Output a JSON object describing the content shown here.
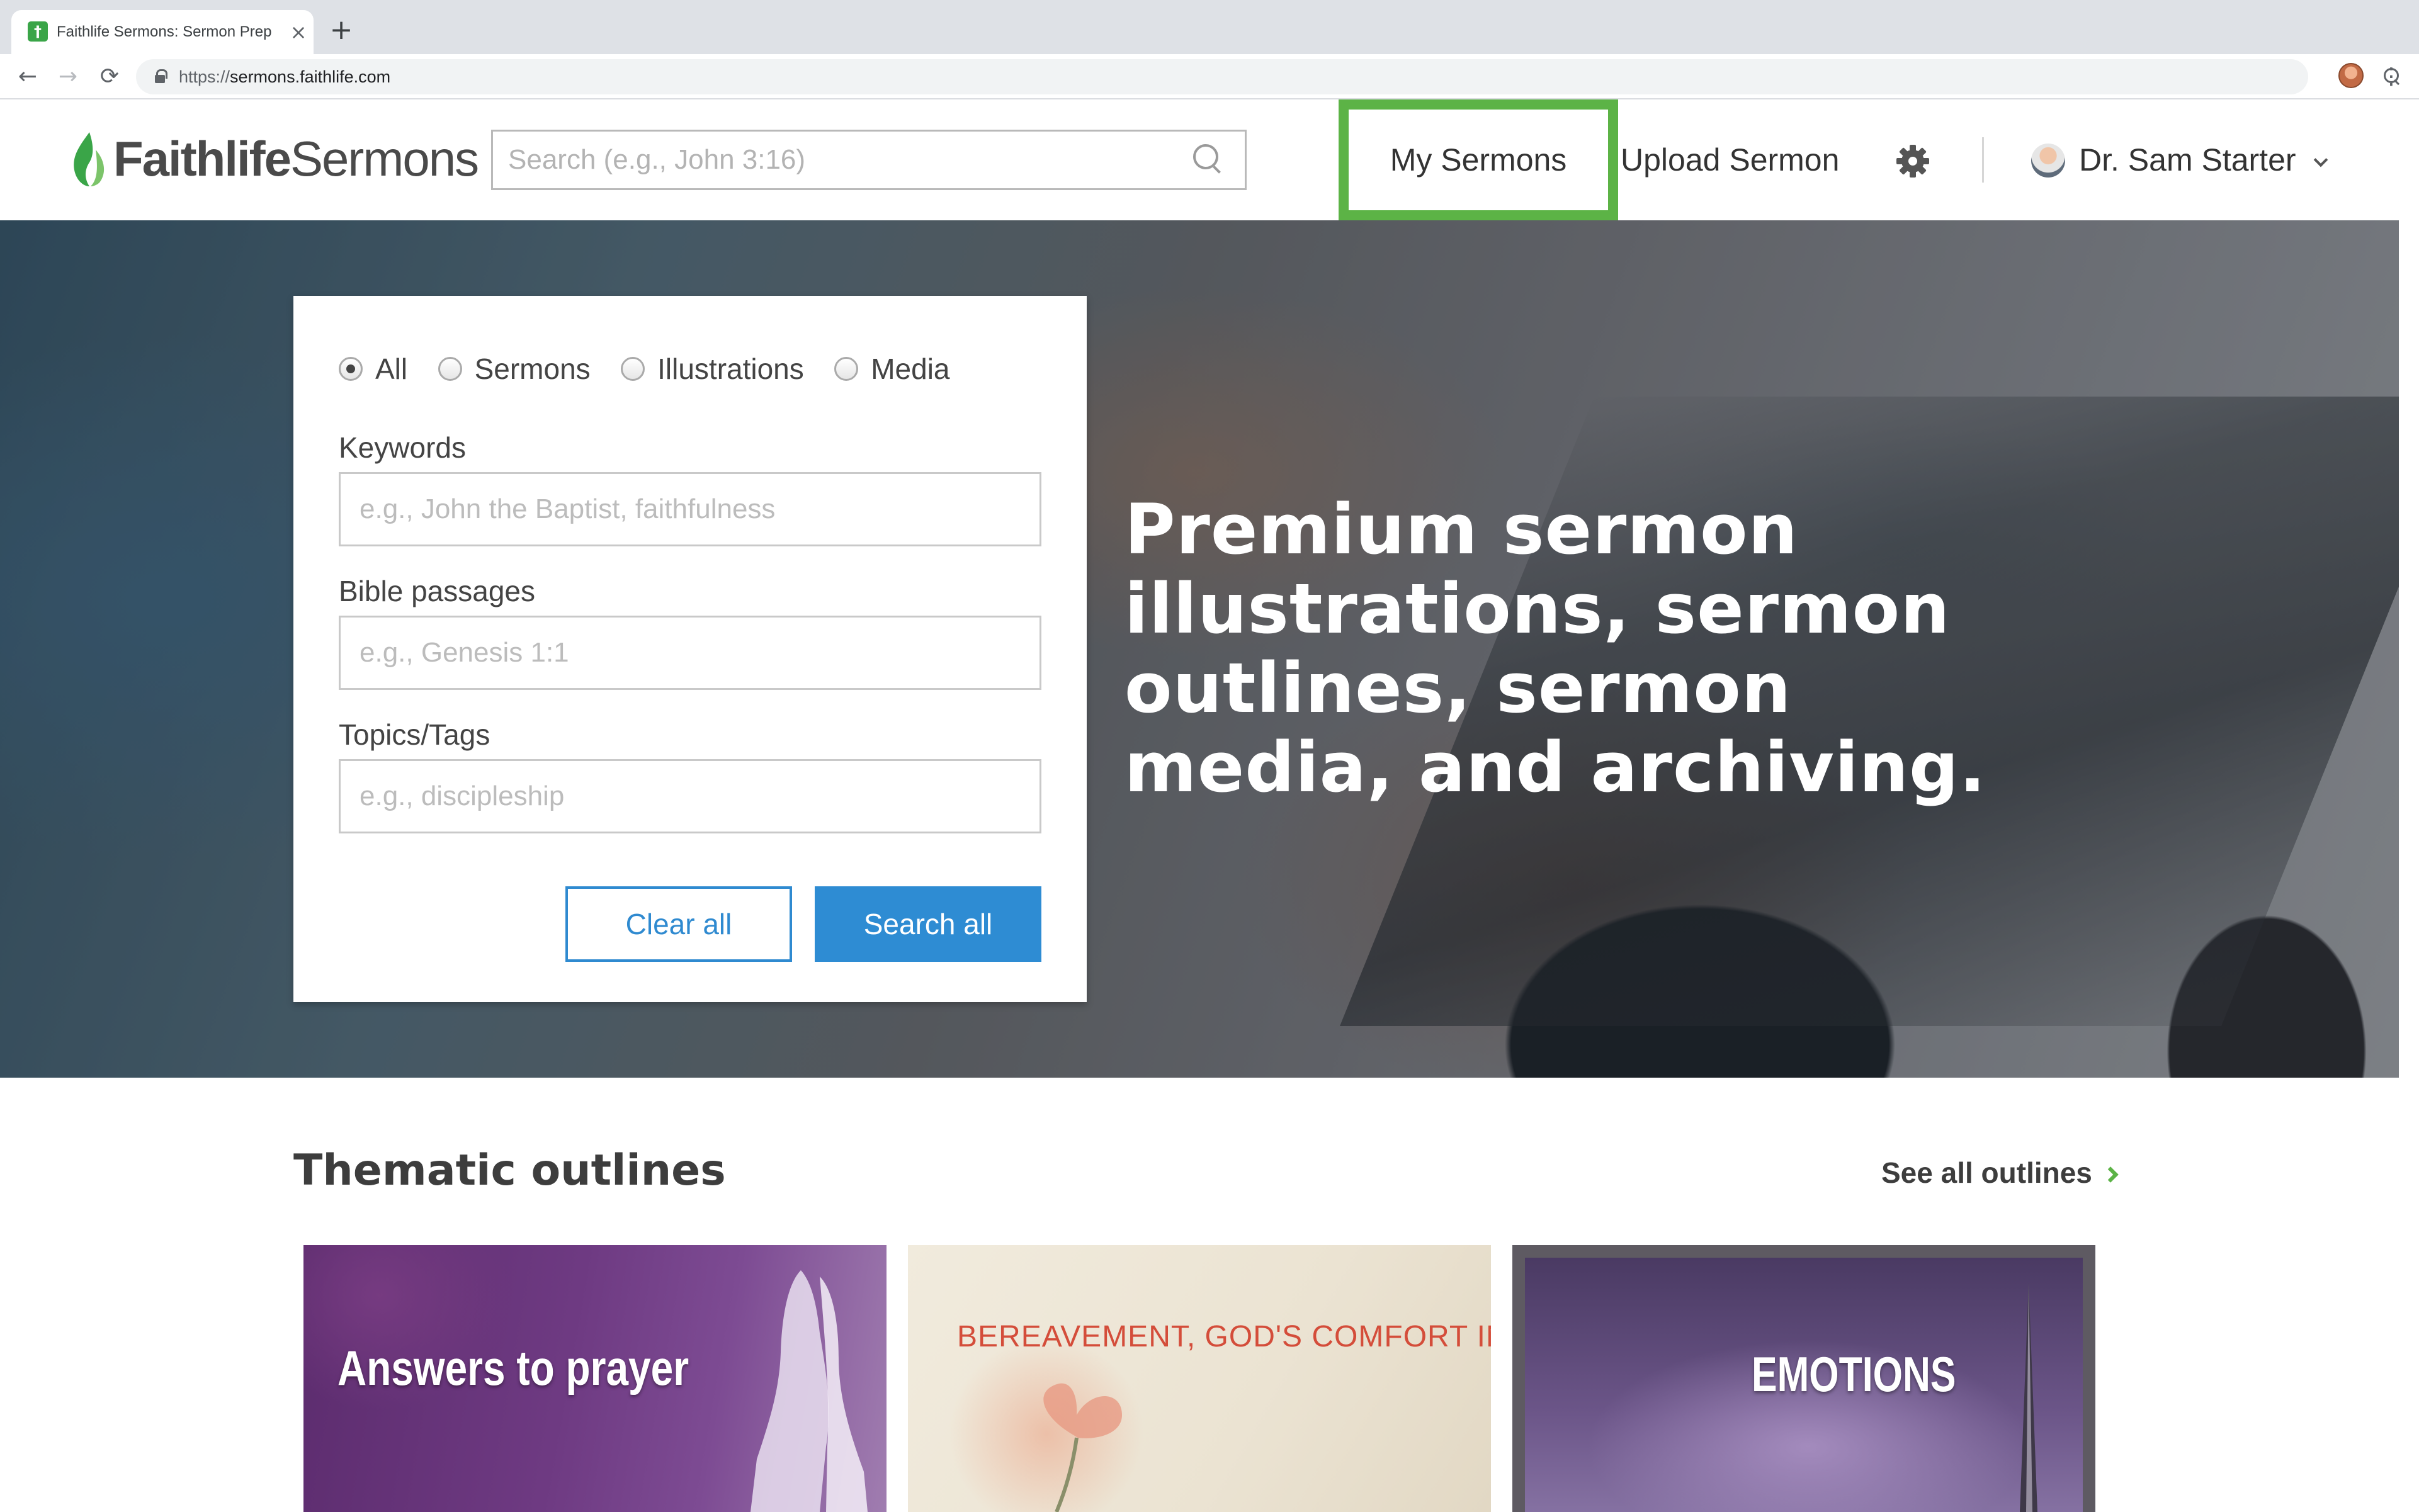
{
  "browser": {
    "tab_title": "Faithlife Sermons: Sermon Prep",
    "tab_close": "×",
    "new_tab": "+",
    "url_scheme": "https://",
    "url_host": "sermons.faithlife.com",
    "back": "←",
    "forward": "→",
    "reload": "⟳",
    "star": "☆",
    "menu": "⋮"
  },
  "header": {
    "logo_bold": "Faithlife",
    "logo_light": "Sermons",
    "search_placeholder": "Search (e.g., John 3:16)",
    "nav": {
      "my_sermons": "My Sermons",
      "upload_sermon": "Upload Sermon"
    },
    "user_name": "Dr. Sam Starter",
    "accent_color": "#5cb346"
  },
  "search_card": {
    "types": [
      "All",
      "Sermons",
      "Illustrations",
      "Media"
    ],
    "selected_type": "All",
    "keywords_label": "Keywords",
    "keywords_placeholder": "e.g., John the Baptist, faithfulness",
    "passages_label": "Bible passages",
    "passages_placeholder": "e.g., Genesis 1:1",
    "topics_label": "Topics/Tags",
    "topics_placeholder": "e.g., discipleship",
    "clear_label": "Clear all",
    "search_label": "Search all",
    "button_color": "#2e8cd3"
  },
  "hero": {
    "headline": "Premium sermon illustrations, sermon outlines, sermon media, and archiving."
  },
  "outlines": {
    "title": "Thematic outlines",
    "see_all": "See all outlines",
    "cards": [
      "Answers to prayer",
      "BEREAVEMENT, GOD'S COMFORT IN",
      "EMOTIONS"
    ]
  }
}
